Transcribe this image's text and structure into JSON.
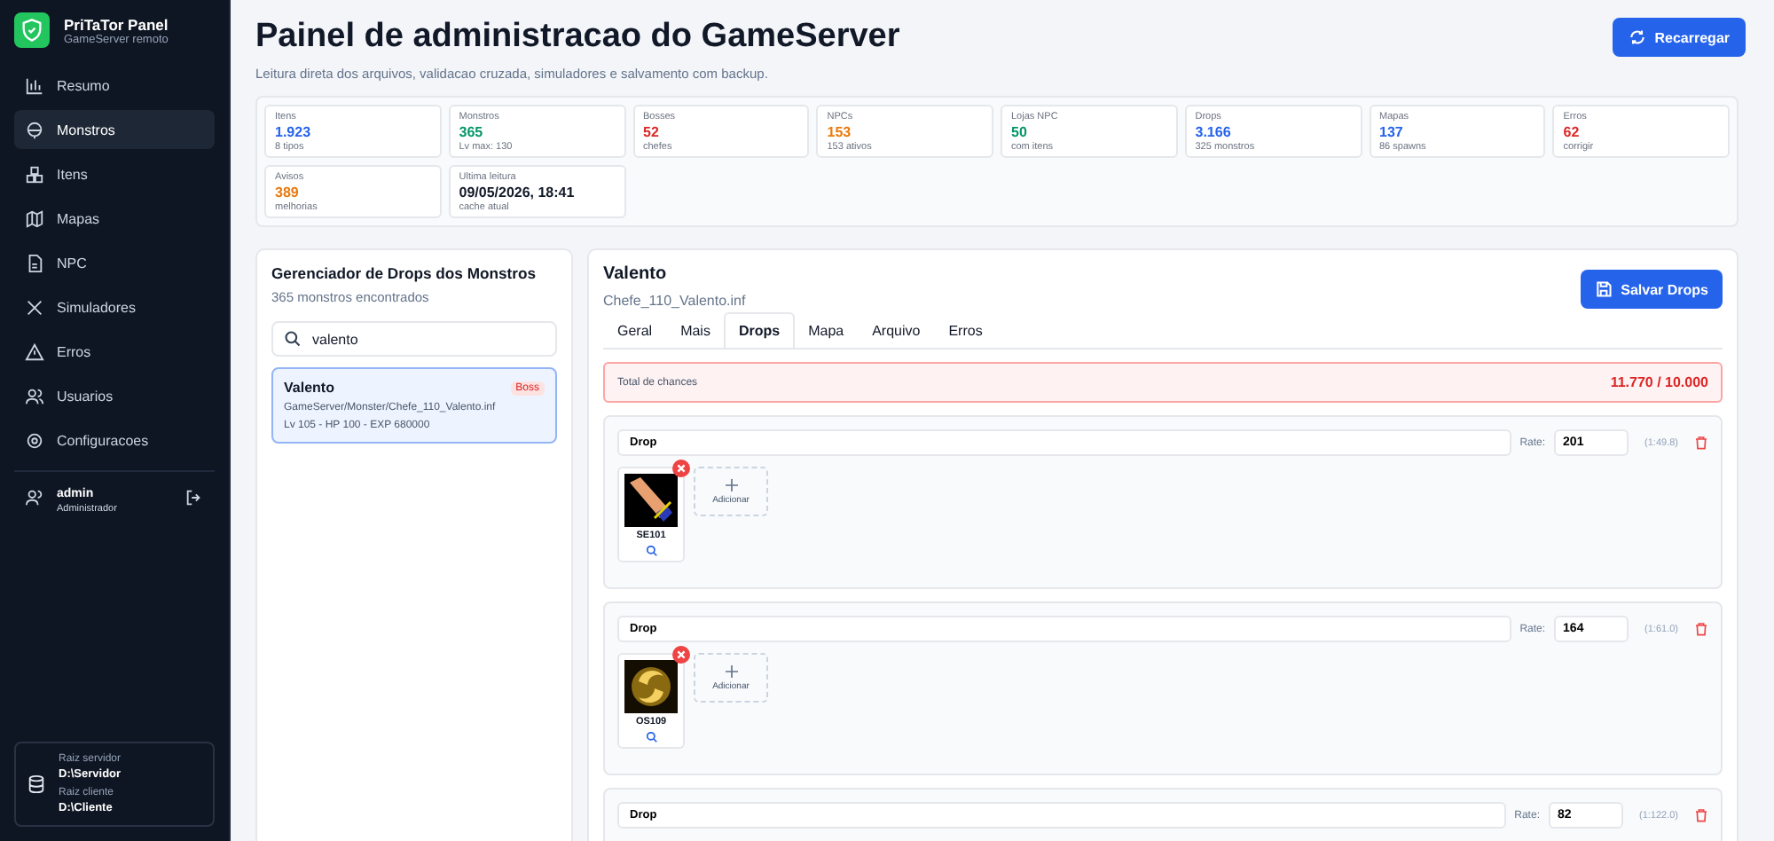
{
  "brand": {
    "title": "PriTaTor Panel",
    "subtitle": "GameServer remoto"
  },
  "nav": [
    {
      "label": "Resumo",
      "selected": false
    },
    {
      "label": "Monstros",
      "selected": true
    },
    {
      "label": "Itens",
      "selected": false
    },
    {
      "label": "Mapas",
      "selected": false
    },
    {
      "label": "NPC",
      "selected": false
    },
    {
      "label": "Simuladores",
      "selected": false
    },
    {
      "label": "Erros",
      "selected": false
    },
    {
      "label": "Usuarios",
      "selected": false
    },
    {
      "label": "Configuracoes",
      "selected": false
    }
  ],
  "user": {
    "name": "admin",
    "role": "Administrador"
  },
  "paths": [
    {
      "label": "Raiz servidor",
      "value": "D:\\Servidor"
    },
    {
      "label": "Raiz cliente",
      "value": "D:\\Cliente"
    }
  ],
  "header": {
    "title": "Painel de administracao do GameServer",
    "subtitle": "Leitura direta dos arquivos, validacao cruzada, simuladores e salvamento com backup.",
    "reload": "Recarregar"
  },
  "stats": [
    {
      "label": "Itens",
      "value": "1.923",
      "note": "8 tipos",
      "color": "#2563eb"
    },
    {
      "label": "Monstros",
      "value": "365",
      "note": "Lv max: 130",
      "color": "#059669"
    },
    {
      "label": "Bosses",
      "value": "52",
      "note": "chefes",
      "color": "#dc2626"
    },
    {
      "label": "NPCs",
      "value": "153",
      "note": "153 ativos",
      "color": "#ea7a0c"
    },
    {
      "label": "Lojas NPC",
      "value": "50",
      "note": "com itens",
      "color": "#059669"
    },
    {
      "label": "Drops",
      "value": "3.166",
      "note": "325 monstros",
      "color": "#2563eb"
    },
    {
      "label": "Mapas",
      "value": "137",
      "note": "86 spawns",
      "color": "#2563eb"
    },
    {
      "label": "Erros",
      "value": "62",
      "note": "corrigir",
      "color": "#dc2626"
    },
    {
      "label": "Avisos",
      "value": "389",
      "note": "melhorias",
      "color": "#ea7a0c"
    },
    {
      "label": "Ultima leitura",
      "value": "09/05/2026, 18:41",
      "note": "cache atual",
      "color": "#111827"
    }
  ],
  "manager": {
    "title": "Gerenciador de Drops dos Monstros",
    "count": "365 monstros encontrados",
    "search": "valento",
    "results": [
      {
        "name": "Valento",
        "badge": "Boss",
        "path": "GameServer/Monster/Chefe_110_Valento.inf",
        "info": "Lv 105 - HP 100 - EXP 680000",
        "selected": true
      }
    ]
  },
  "detail": {
    "title": "Valento",
    "file": "Chefe_110_Valento.inf",
    "save": "Salvar Drops",
    "tabs": [
      {
        "label": "Geral",
        "selected": false
      },
      {
        "label": "Mais",
        "selected": false
      },
      {
        "label": "Drops",
        "selected": true
      },
      {
        "label": "Mapa",
        "selected": false
      },
      {
        "label": "Arquivo",
        "selected": false
      },
      {
        "label": "Erros",
        "selected": false
      }
    ],
    "total": {
      "label": "Total de chances",
      "value": "11.770 / 10.000",
      "over": true
    },
    "groups": [
      {
        "name": "Drop",
        "rate_label": "Rate:",
        "rate": "201",
        "ratio": "(1:49.8)",
        "add_label": "Adicionar",
        "items": [
          {
            "code": "SE101",
            "kind": "sword"
          }
        ]
      },
      {
        "name": "Drop",
        "rate_label": "Rate:",
        "rate": "164",
        "ratio": "(1:61.0)",
        "add_label": "Adicionar",
        "items": [
          {
            "code": "OS109",
            "kind": "orb"
          }
        ]
      },
      {
        "name": "Drop",
        "rate_label": "Rate:",
        "rate": "82",
        "ratio": "(1:122.0)"
      }
    ]
  }
}
